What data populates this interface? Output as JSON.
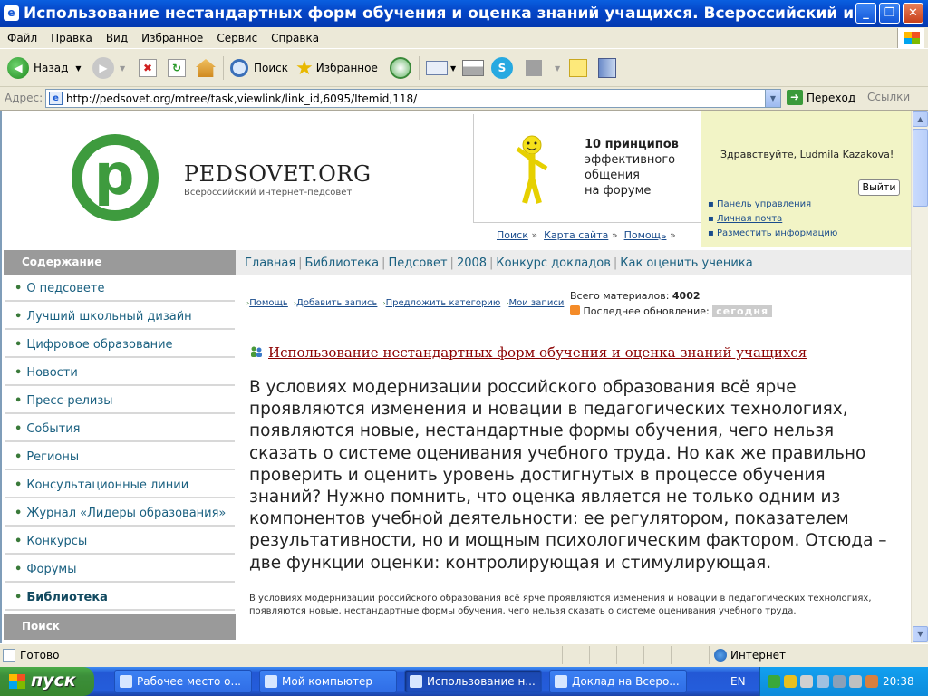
{
  "window": {
    "title": "Использование нестандартных форм обучения и оценка знаний учащихся. Всероссийский интер...",
    "minimize": "_",
    "maximize": "❐",
    "close": "✕"
  },
  "menu": [
    "Файл",
    "Правка",
    "Вид",
    "Избранное",
    "Сервис",
    "Справка"
  ],
  "toolbar": {
    "back": "Назад",
    "search": "Поиск",
    "favorites": "Избранное"
  },
  "address": {
    "label": "Адрес:",
    "url": "http://pedsovet.org/mtree/task,viewlink/link_id,6095/Itemid,118/",
    "go": "Переход",
    "links": "Ссылки"
  },
  "site": {
    "name": "PEDSOVET.ORG",
    "tagline": "Всероссийский интернет-педсовет",
    "promo": {
      "bold": "10 принципов",
      "rest": [
        "эффективного",
        "общения",
        "на форуме"
      ]
    },
    "toplinks": [
      "Поиск",
      "Карта сайта",
      "Помощь"
    ],
    "welcome": "Здравствуйте, Ludmila Kazakova!",
    "logout": "Выйти",
    "account_links": [
      "Панель управления",
      "Личная почта",
      "Разместить информацию"
    ]
  },
  "nav": {
    "heading": "Содержание",
    "items": [
      "О педсовете",
      "Лучший школьный дизайн",
      "Цифровое образование",
      "Новости",
      "Пресс-релизы",
      "События",
      "Регионы",
      "Консультационные линии",
      "Журнал «Лидеры образования»",
      "Конкурсы",
      "Форумы",
      "Библиотека"
    ],
    "search_heading": "Поиск"
  },
  "crumbs": [
    "Главная",
    "Библиотека",
    "Педсовет",
    "2008",
    "Конкурс докладов",
    "Как оценить ученика"
  ],
  "sublinks": [
    "Помощь",
    "Добавить запись",
    "Предложить категорию",
    "Мои записи"
  ],
  "stats": {
    "total_label": "Всего материалов:",
    "total": "4002",
    "updated_label": "Последнее обновление:",
    "updated": "сегодня"
  },
  "article": {
    "title": "Использование нестандартных форм обучения и оценка знаний учащихся",
    "big": "В условиях модернизации российского образования всё ярче проявляются изменения и новации в педагогических технологиях, появляются новые, нестандартные формы обучения, чего нельзя сказать о системе оценивания учебного труда. Но как же правильно проверить и оценить уровень достигнутых в процессе обучения знаний? Нужно помнить, что оценка является не только одним из компонентов учебной деятельности: ее регулятором, показателем результативности, но и мощным психологическим фактором. Отсюда – две функции оценки: контролирующая и стимулирующая.",
    "small": "В условиях модернизации российского образования всё ярче проявляются изменения и новации в педагогических технологиях, появляются новые, нестандартные формы обучения, чего нельзя сказать о системе оценивания учебного труда."
  },
  "status": {
    "text": "Готово",
    "zone": "Интернет"
  },
  "taskbar": {
    "start": "пуск",
    "tasks": [
      "Рабочее место о...",
      "Мой компьютер",
      "Использование н...",
      "Доклад на Всеро..."
    ],
    "lang": "EN",
    "clock": "20:38"
  }
}
